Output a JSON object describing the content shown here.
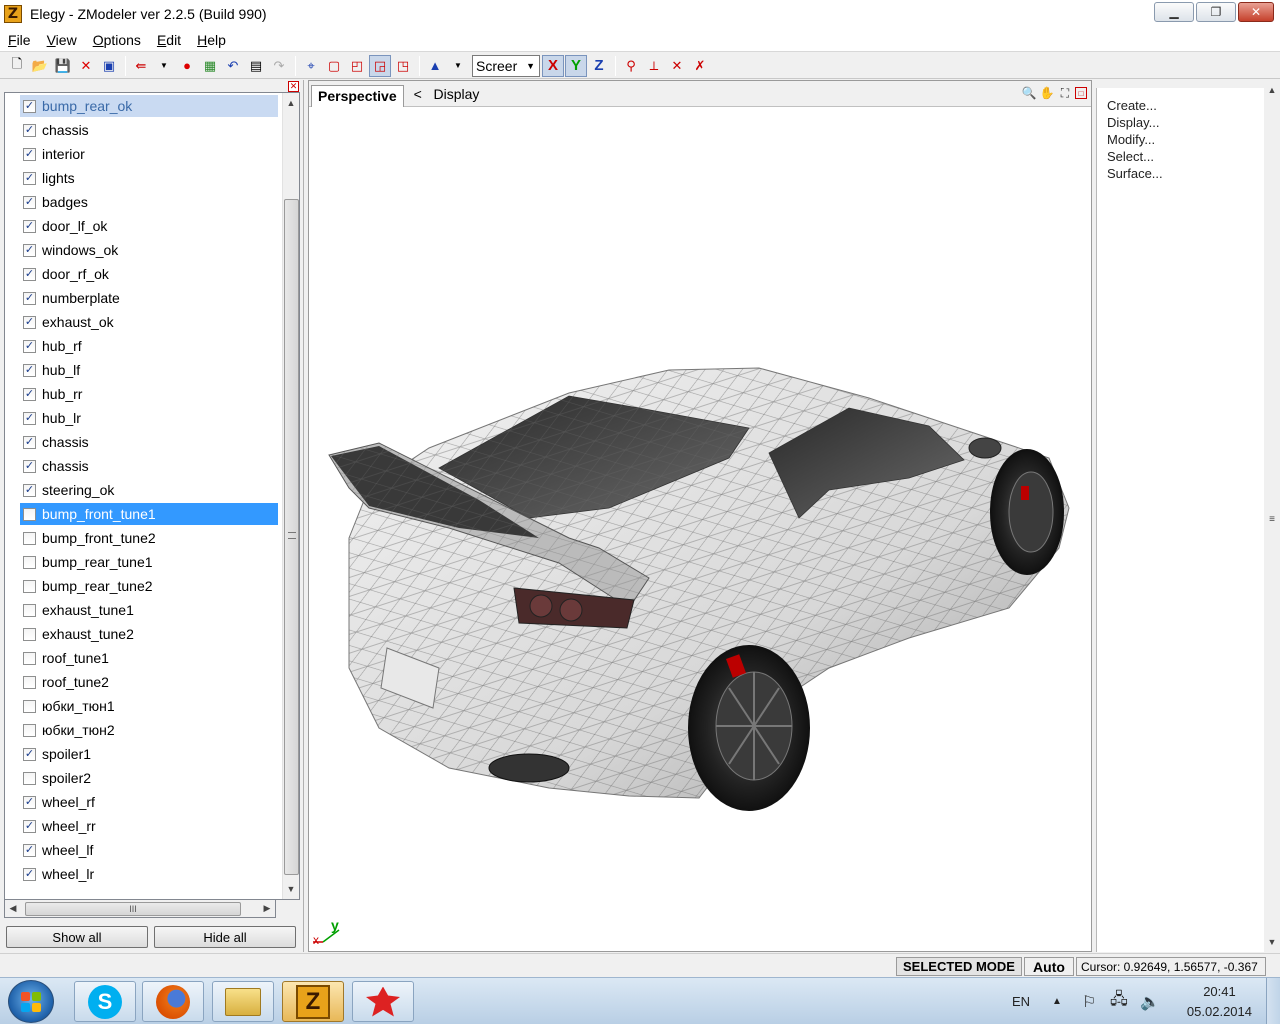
{
  "window": {
    "title": "Elegy - ZModeler ver 2.2.5 (Build 990)",
    "app_icon_letter": "Z",
    "minimize": "▁",
    "maximize": "❐",
    "close": "✕"
  },
  "menu": [
    {
      "label": "File",
      "ul": "F",
      "rest": "ile"
    },
    {
      "label": "View",
      "ul": "V",
      "rest": "iew"
    },
    {
      "label": "Options",
      "ul": "O",
      "rest": "ptions"
    },
    {
      "label": "Edit",
      "ul": "E",
      "rest": "dit"
    },
    {
      "label": "Help",
      "ul": "H",
      "rest": "elp"
    }
  ],
  "toolbar": {
    "space_select": "Screer",
    "axis_x": "X",
    "axis_y": "Y",
    "axis_z": "Z"
  },
  "objects": [
    {
      "name": "bump_rear_ok",
      "checked": true
    },
    {
      "name": "chassis",
      "checked": true
    },
    {
      "name": "interior",
      "checked": true
    },
    {
      "name": "lights",
      "checked": true
    },
    {
      "name": "badges",
      "checked": true
    },
    {
      "name": "door_lf_ok",
      "checked": true
    },
    {
      "name": "windows_ok",
      "checked": true
    },
    {
      "name": "door_rf_ok",
      "checked": true
    },
    {
      "name": "numberplate",
      "checked": true
    },
    {
      "name": "exhaust_ok",
      "checked": true
    },
    {
      "name": "hub_rf",
      "checked": true
    },
    {
      "name": "hub_lf",
      "checked": true
    },
    {
      "name": "hub_rr",
      "checked": true
    },
    {
      "name": "hub_lr",
      "checked": true
    },
    {
      "name": "chassis",
      "checked": true
    },
    {
      "name": "chassis",
      "checked": true
    },
    {
      "name": "steering_ok",
      "checked": true
    },
    {
      "name": "bump_front_tune1",
      "checked": false
    },
    {
      "name": "bump_front_tune2",
      "checked": false
    },
    {
      "name": "bump_rear_tune1",
      "checked": false
    },
    {
      "name": "bump_rear_tune2",
      "checked": false
    },
    {
      "name": "exhaust_tune1",
      "checked": false
    },
    {
      "name": "exhaust_tune2",
      "checked": false
    },
    {
      "name": "roof_tune1",
      "checked": false
    },
    {
      "name": "roof_tune2",
      "checked": false
    },
    {
      "name": "юбки_тюн1",
      "checked": false
    },
    {
      "name": "юбки_тюн2",
      "checked": false
    },
    {
      "name": "spoiler1",
      "checked": true
    },
    {
      "name": "spoiler2",
      "checked": false
    },
    {
      "name": "wheel_rf",
      "checked": true
    },
    {
      "name": "wheel_rr",
      "checked": true
    },
    {
      "name": "wheel_lf",
      "checked": true
    },
    {
      "name": "wheel_lr",
      "checked": true
    }
  ],
  "left_panel": {
    "show_all": "Show all",
    "hide_all": "Hide all",
    "hscroll_grip": "III"
  },
  "viewport": {
    "tab": "Perspective",
    "back_arrow": "<",
    "display": "Display",
    "axis_x": "x",
    "axis_y": "y"
  },
  "commands": [
    "Create...",
    "Display...",
    "Modify...",
    "Select...",
    "Surface..."
  ],
  "status": {
    "mode": "SELECTED MODE",
    "auto": "Auto",
    "cursor": "Cursor: 0.92649, 1.56577, -0.367"
  },
  "taskbar": {
    "language": "EN",
    "time": "20:41",
    "date": "05.02.2014",
    "apps": [
      "skype-icon",
      "firefox-icon",
      "explorer-icon",
      "zmodeler-icon",
      "red-app-icon"
    ]
  },
  "colors": {
    "selection": "#3399ff",
    "first_item_bg": "#c9daf2",
    "axis_x": "#cc0000",
    "axis_y": "#00a000",
    "axis_z": "#1a3fb0"
  }
}
